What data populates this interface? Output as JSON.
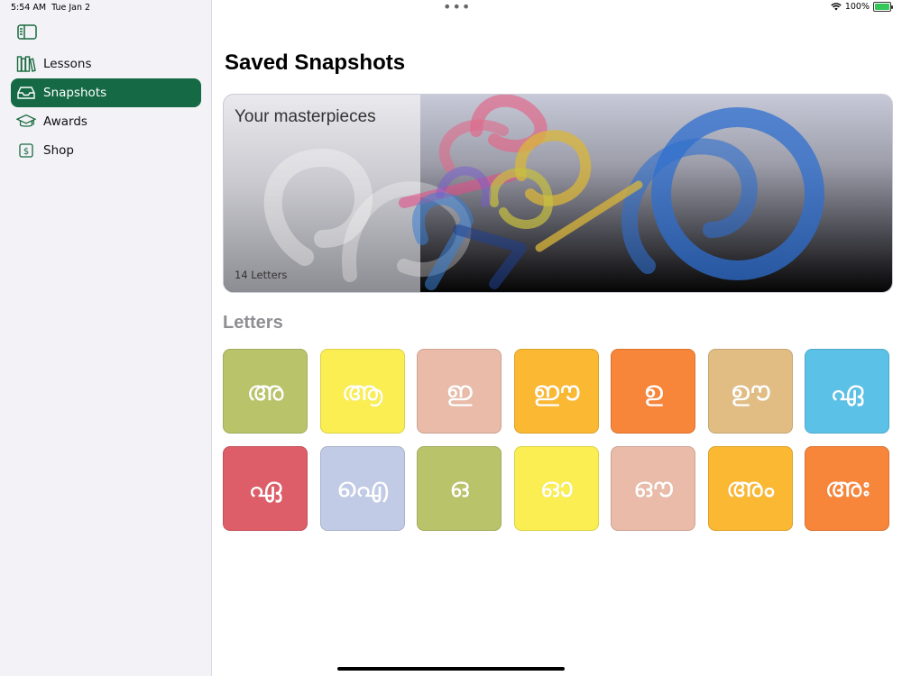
{
  "status": {
    "time": "5:54 AM",
    "date": "Tue Jan 2",
    "battery": "100%",
    "battery_level": 1.0
  },
  "sidebar": {
    "toggle_icon": "sidebar-icon",
    "items": [
      {
        "label": "Lessons",
        "icon": "books-icon",
        "active": false
      },
      {
        "label": "Snapshots",
        "icon": "tray-icon",
        "active": true
      },
      {
        "label": "Awards",
        "icon": "graduation-cap-icon",
        "active": false
      },
      {
        "label": "Shop",
        "icon": "dollar-sign-icon",
        "active": false
      }
    ]
  },
  "main": {
    "title": "Saved Snapshots",
    "hero": {
      "title": "Your masterpieces",
      "count": "14 Letters"
    },
    "letters_title": "Letters",
    "letters": [
      {
        "char": "അ",
        "color": "#b9c46a"
      },
      {
        "char": "ആ",
        "color": "#fbee52"
      },
      {
        "char": "ഇ",
        "color": "#e9bba8"
      },
      {
        "char": "ഈ",
        "color": "#fbb832"
      },
      {
        "char": "ഉ",
        "color": "#f7853a"
      },
      {
        "char": "ഊ",
        "color": "#e1bd84"
      },
      {
        "char": "ഏ",
        "color": "#5cc1e7"
      },
      {
        "char": "ഏ",
        "color": "#dd5e69"
      },
      {
        "char": "ഐ",
        "color": "#c2cbe6"
      },
      {
        "char": "ഒ",
        "color": "#b9c46a"
      },
      {
        "char": "ഓ",
        "color": "#fbee52"
      },
      {
        "char": "ഔ",
        "color": "#e9bba8"
      },
      {
        "char": "അം",
        "color": "#fbb832"
      },
      {
        "char": "അഃ",
        "color": "#f7853a"
      }
    ]
  },
  "colors": {
    "accent": "#156a45",
    "sidebar_bg": "#f2f2f7"
  }
}
